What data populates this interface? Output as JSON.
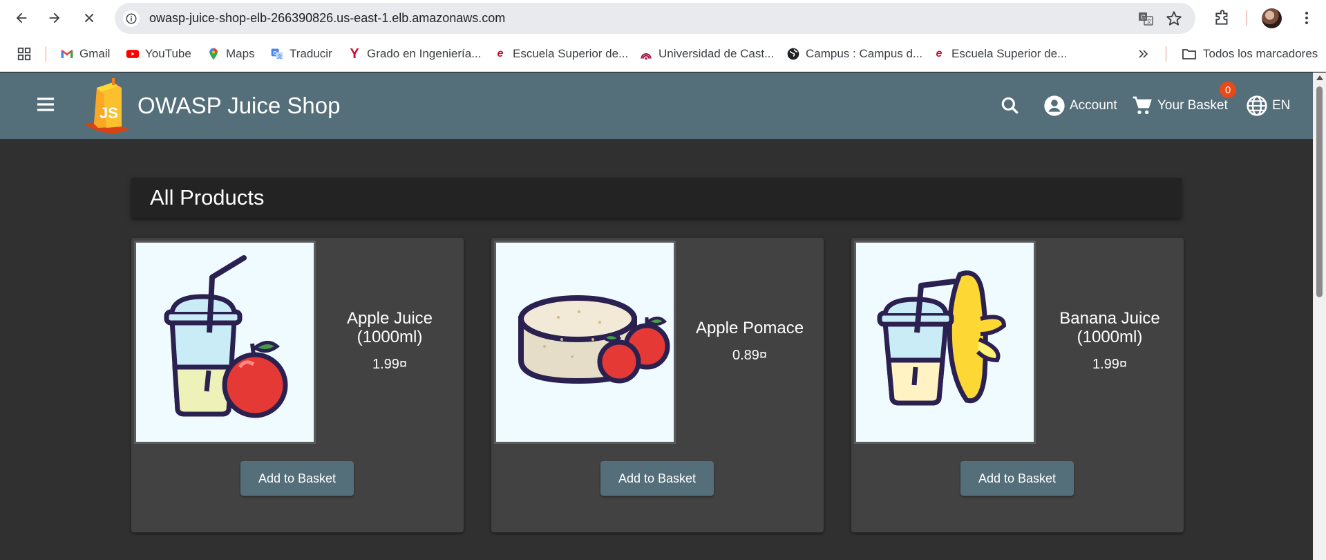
{
  "browser": {
    "url": "owasp-juice-shop-elb-266390826.us-east-1.elb.amazonaws.com",
    "bookmarks": [
      {
        "label": "Gmail",
        "icon": "gmail-icon"
      },
      {
        "label": "YouTube",
        "icon": "youtube-icon"
      },
      {
        "label": "Maps",
        "icon": "maps-icon"
      },
      {
        "label": "Traducir",
        "icon": "translate-icon"
      },
      {
        "label": "Grado en Ingeniería...",
        "icon": "y-logo-icon"
      },
      {
        "label": "Escuela Superior de...",
        "icon": "esi-logo-icon"
      },
      {
        "label": "Universidad de Cast...",
        "icon": "uclm-logo-icon"
      },
      {
        "label": "Campus : Campus d...",
        "icon": "globe-icon"
      },
      {
        "label": "Escuela Superior de...",
        "icon": "esi-logo-icon"
      }
    ],
    "all_bookmarks_label": "Todos los marcadores"
  },
  "app": {
    "title": "OWASP Juice Shop",
    "account_label": "Account",
    "basket_label": "Your Basket",
    "basket_count": "0",
    "language": "EN"
  },
  "main": {
    "heading": "All Products",
    "products": [
      {
        "name": "Apple Juice (1000ml)",
        "price": "1.99¤",
        "button": "Add to Basket"
      },
      {
        "name": "Apple Pomace",
        "price": "0.89¤",
        "button": "Add to Basket"
      },
      {
        "name": "Banana Juice (1000ml)",
        "price": "1.99¤",
        "button": "Add to Basket"
      }
    ]
  },
  "colors": {
    "toolbar": "#546e7a",
    "background": "#303030",
    "card": "#424242",
    "badge": "#e64a19"
  }
}
